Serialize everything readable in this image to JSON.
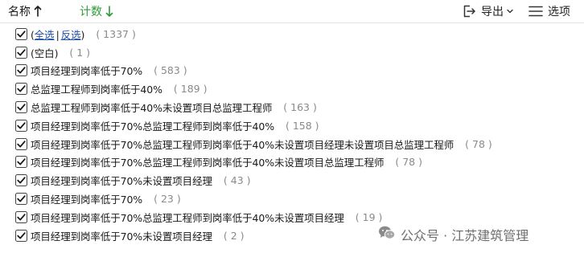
{
  "header": {
    "sort_name_label": "名称",
    "sort_count_label": "计数",
    "export_label": "导出",
    "options_label": "选项"
  },
  "select_all": {
    "open_paren": "(",
    "select_all_label": "全选",
    "separator": "|",
    "invert_label": "反选",
    "close_paren": ")",
    "count": "( 1337 )"
  },
  "items": [
    {
      "label": "(空白)",
      "count": "( 1 )"
    },
    {
      "label": "项目经理到岗率低于70%",
      "count": "( 583 )"
    },
    {
      "label": "总监理工程师到岗率低于40%",
      "count": "( 189 )"
    },
    {
      "label": "总监理工程师到岗率低于40%未设置项目总监理工程师",
      "count": "( 163 )"
    },
    {
      "label": "项目经理到岗率低于70%总监理工程师到岗率低于40%",
      "count": "( 158 )"
    },
    {
      "label": "项目经理到岗率低于70%总监理工程师到岗率低于40%未设置项目经理未设置项目总监理工程师",
      "count": "( 78 )"
    },
    {
      "label": "项目经理到岗率低于70%总监理工程师到岗率低于40%未设置项目总监理工程师",
      "count": "( 78 )"
    },
    {
      "label": "项目经理到岗率低于70%未设置项目经理",
      "count": "( 43 )"
    },
    {
      "label": "项目经理到岗率低于70%",
      "count": "( 23 )"
    },
    {
      "label": "项目经理到岗率低于70%总监理工程师到岗率低于40%未设置项目经理",
      "count": "( 19 )"
    },
    {
      "label": "项目经理到岗率低于70%未设置项目经理",
      "count": "( 2 )"
    }
  ],
  "watermark": {
    "text": "公众号 · 江苏建筑管理"
  },
  "colors": {
    "count_sort_accent": "#2e9a3a",
    "link": "#1f4fa8",
    "count_text": "#8a8a8a"
  },
  "icons": {
    "sort_name": "arrow-up-icon",
    "sort_count": "arrow-down-icon",
    "export": "export-icon",
    "options": "menu-lines-icon",
    "checkbox": "checkbox-checked-icon",
    "watermark": "wechat-icon"
  }
}
